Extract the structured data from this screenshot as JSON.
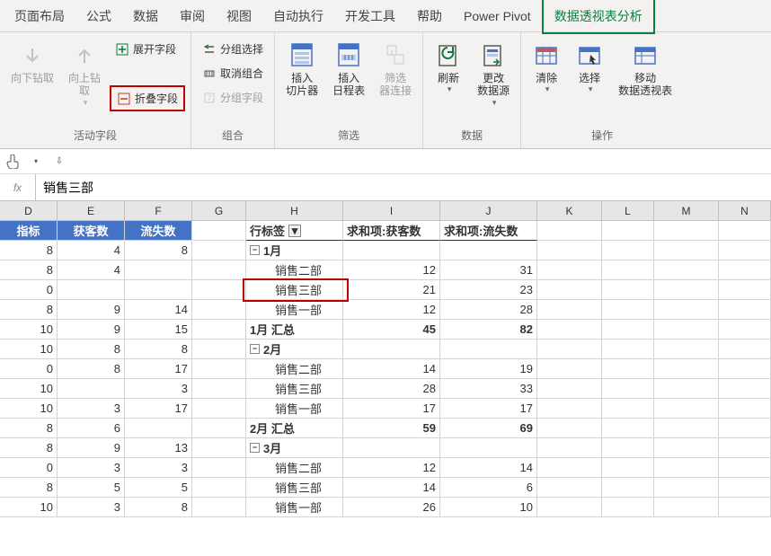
{
  "tabs": [
    "页面布局",
    "公式",
    "数据",
    "审阅",
    "视图",
    "自动执行",
    "开发工具",
    "帮助",
    "Power Pivot",
    "数据透视表分析"
  ],
  "active_tab": 9,
  "ribbon_groups": {
    "active_field": {
      "label": "活动字段",
      "drill_down": "向下钻取",
      "drill_up": "向上钻\n取",
      "expand": "展开字段",
      "collapse": "折叠字段"
    },
    "group": {
      "label": "组合",
      "group_selection": "分组选择",
      "ungroup": "取消组合",
      "group_field": "分组字段"
    },
    "filter": {
      "label": "筛选",
      "slicer": "插入\n切片器",
      "timeline": "插入\n日程表",
      "connections": "筛选\n器连接"
    },
    "data": {
      "label": "数据",
      "refresh": "刷新",
      "change_source": "更改\n数据源"
    },
    "actions": {
      "label": "操作",
      "clear": "清除",
      "select": "选择",
      "move": "移动\n数据透视表"
    }
  },
  "formula_bar": {
    "value": "销售三部"
  },
  "columns": [
    "D",
    "E",
    "F",
    "G",
    "H",
    "I",
    "J",
    "K",
    "L",
    "M",
    "N"
  ],
  "left_headers": [
    "指标",
    "获客数",
    "流失数"
  ],
  "left_rows": [
    [
      "8",
      "4",
      "8"
    ],
    [
      "8",
      "4",
      ""
    ],
    [
      "0",
      "",
      ""
    ],
    [
      "8",
      "9",
      "14"
    ],
    [
      "10",
      "9",
      "15"
    ],
    [
      "10",
      "8",
      "8"
    ],
    [
      "0",
      "8",
      "17"
    ],
    [
      "10",
      "",
      "3"
    ],
    [
      "10",
      "3",
      "17"
    ],
    [
      "8",
      "6",
      ""
    ],
    [
      "8",
      "9",
      "13"
    ],
    [
      "0",
      "3",
      "3"
    ],
    [
      "8",
      "5",
      "5"
    ],
    [
      "10",
      "3",
      "8"
    ]
  ],
  "pivot": {
    "headers": [
      "行标签",
      "求和项:获客数",
      "求和项:流失数"
    ],
    "rows": [
      {
        "type": "month",
        "label": "1月",
        "expand": "-"
      },
      {
        "type": "dept",
        "label": "销售二部",
        "v1": 12,
        "v2": 31
      },
      {
        "type": "dept",
        "label": "销售三部",
        "v1": 21,
        "v2": 23,
        "selected": true
      },
      {
        "type": "dept",
        "label": "销售一部",
        "v1": 12,
        "v2": 28
      },
      {
        "type": "total",
        "label": "1月 汇总",
        "v1": 45,
        "v2": 82
      },
      {
        "type": "month",
        "label": "2月",
        "expand": "-"
      },
      {
        "type": "dept",
        "label": "销售二部",
        "v1": 14,
        "v2": 19
      },
      {
        "type": "dept",
        "label": "销售三部",
        "v1": 28,
        "v2": 33
      },
      {
        "type": "dept",
        "label": "销售一部",
        "v1": 17,
        "v2": 17
      },
      {
        "type": "total",
        "label": "2月 汇总",
        "v1": 59,
        "v2": 69
      },
      {
        "type": "month",
        "label": "3月",
        "expand": "-"
      },
      {
        "type": "dept",
        "label": "销售二部",
        "v1": 12,
        "v2": 14
      },
      {
        "type": "dept",
        "label": "销售三部",
        "v1": 14,
        "v2": 6
      },
      {
        "type": "dept",
        "label": "销售一部",
        "v1": 26,
        "v2": 10
      }
    ]
  }
}
